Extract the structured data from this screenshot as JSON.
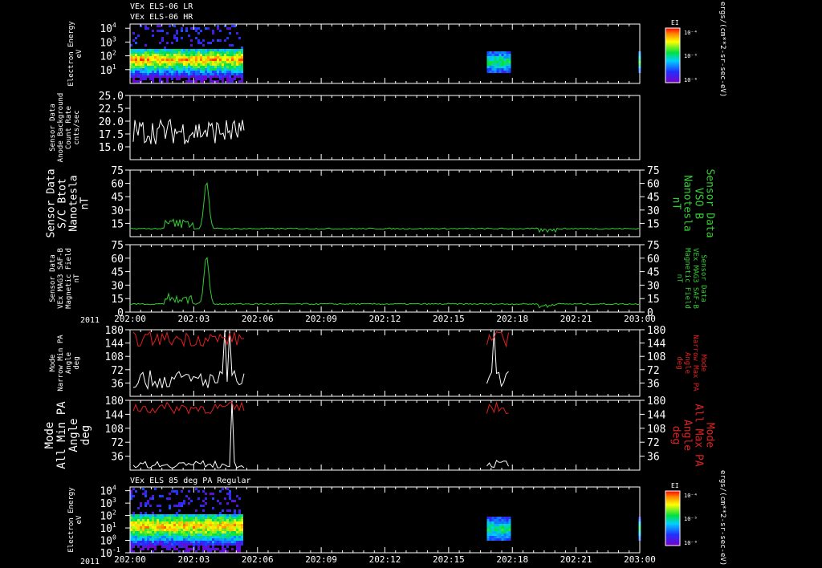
{
  "titles": {
    "top": [
      "VEx ELS-06 LR",
      "VEx ELS-06 HR"
    ],
    "bottom": "VEx ELS 85 deg PA Regular"
  },
  "time_axis": {
    "year": "2011",
    "ticks": [
      "202:00",
      "202:03",
      "202:06",
      "202:09",
      "202:12",
      "202:15",
      "202:18",
      "202:21",
      "203:00"
    ]
  },
  "colorbar": {
    "label": "EI",
    "unit_label": "ergs/(cm**2-sr-sec-eV)",
    "tick_labels": [
      "10⁻⁴",
      "10⁻⁵",
      "10⁻⁶"
    ]
  },
  "colors": {
    "background": "#000000",
    "axis": "#ffffff",
    "green": "#33cc33",
    "red": "#e02020",
    "white": "#ffffff"
  },
  "chart_data": [
    {
      "type": "heatmap",
      "panel": "spec_top",
      "ylabel": [
        "Electron Energy",
        "eV"
      ],
      "y_scale": "log",
      "ylim": [
        1,
        20000
      ],
      "y_ticks": [
        {
          "exp": "1",
          "v": 10
        },
        {
          "exp": "2",
          "v": 100
        },
        {
          "exp": "3",
          "v": 1000
        },
        {
          "exp": "4",
          "v": 10000
        }
      ],
      "y_tick_base": "10",
      "segments": [
        [
          0,
          1.75
        ],
        [
          5.6,
          5.95
        ],
        [
          7.98,
          8.0
        ]
      ]
    },
    {
      "type": "line",
      "panel": "bg",
      "ylabel": [
        "Sensor Data",
        "Anode Background",
        "Count Rate",
        "cnts/sec"
      ],
      "ylim": [
        12.5,
        25.0
      ],
      "y_ticks": [
        "15.0",
        "17.5",
        "20.0",
        "22.5",
        "25.0"
      ],
      "series": [
        {
          "color": "#ffffff",
          "x_range": [
            0.05,
            1.8
          ],
          "mean": 18.0,
          "amp": 2.5
        }
      ]
    },
    {
      "type": "line",
      "panel": "bmag",
      "ylabel": [
        "Sensor Data",
        "S/C Btot",
        "Nanotesla",
        "nT"
      ],
      "ylabel_right": [
        "Sensor Data",
        "VSO B",
        "Nanotesla",
        "nT"
      ],
      "ylim": [
        0,
        75
      ],
      "y_ticks": [
        "15",
        "30",
        "45",
        "60",
        "75"
      ],
      "series": [
        {
          "color": "#33cc33",
          "baseline": 9,
          "spike_x": 1.2,
          "spike_y": 62
        }
      ]
    },
    {
      "type": "line",
      "panel": "mag3",
      "ylabel": [
        "Sensor Data",
        "VEx MAG3 SAF-B",
        "Magnetic Field",
        "nT"
      ],
      "ylabel_right": [
        "Sensor Data",
        "VEx MAG3 SAF-B",
        "Magnetic Field",
        "nT"
      ],
      "ylim": [
        0,
        75
      ],
      "y_ticks": [
        "0",
        "15",
        "30",
        "45",
        "60",
        "75"
      ],
      "series": [
        {
          "color": "#33cc33",
          "baseline": 9,
          "spike_x": 1.2,
          "spike_y": 62
        }
      ]
    },
    {
      "type": "line",
      "panel": "pa_narrow",
      "ylabel": [
        "Mode",
        "Narrow Min PA",
        "Angle",
        "deg"
      ],
      "ylabel_right": [
        "Mode",
        "Narrow Max PA",
        "Angle",
        "deg"
      ],
      "ylim": [
        0,
        180
      ],
      "y_ticks": [
        "36",
        "72",
        "108",
        "144",
        "180"
      ],
      "series": [
        {
          "name": "min",
          "color": "#ffffff",
          "mean": 45,
          "amp": 25
        },
        {
          "name": "max",
          "color": "#e02020",
          "mean": 155,
          "amp": 20
        }
      ]
    },
    {
      "type": "line",
      "panel": "pa_all",
      "ylabel": [
        "Mode",
        "All Min PA",
        "Angle",
        "deg"
      ],
      "ylabel_right": [
        "Mode",
        "All Max PA",
        "Angle",
        "deg"
      ],
      "ylim": [
        0,
        180
      ],
      "y_ticks": [
        "36",
        "72",
        "108",
        "144",
        "180"
      ],
      "series": [
        {
          "name": "min",
          "color": "#ffffff",
          "mean": 15,
          "amp": 10
        },
        {
          "name": "max",
          "color": "#e02020",
          "mean": 160,
          "amp": 15
        }
      ]
    },
    {
      "type": "heatmap",
      "panel": "spec_bottom",
      "ylabel": [
        "Electron Energy",
        "eV"
      ],
      "y_scale": "log",
      "ylim": [
        0.1,
        20000
      ],
      "y_ticks": [
        {
          "exp": "-1",
          "v": 0.1
        },
        {
          "exp": "0",
          "v": 1
        },
        {
          "exp": "1",
          "v": 10
        },
        {
          "exp": "2",
          "v": 100
        },
        {
          "exp": "3",
          "v": 1000
        },
        {
          "exp": "4",
          "v": 10000
        }
      ],
      "y_tick_base": "10",
      "segments": [
        [
          0,
          1.75
        ],
        [
          5.6,
          5.95
        ],
        [
          7.98,
          8.0
        ]
      ]
    }
  ]
}
